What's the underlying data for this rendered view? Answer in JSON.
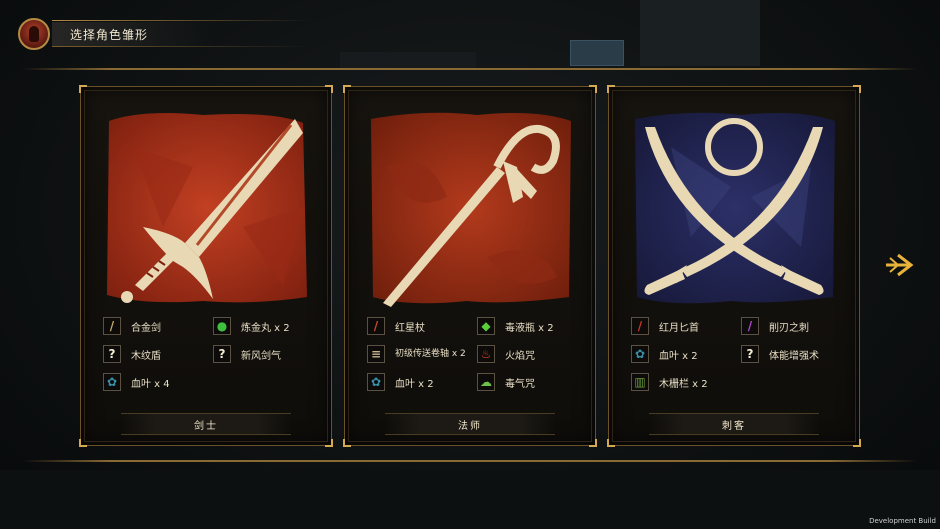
{
  "header": {
    "title": "选择角色雏形"
  },
  "cards": [
    {
      "class_name": "剑士",
      "items": [
        {
          "label": "合金剑",
          "icon": "sword-icon",
          "glyph": "/"
        },
        {
          "label": "炼金丸 x 2",
          "icon": "green-pill-icon",
          "glyph": "●"
        },
        {
          "label": "木纹盾",
          "icon": "unknown-icon",
          "glyph": "?"
        },
        {
          "label": "新风剑气",
          "icon": "unknown-icon",
          "glyph": "?"
        },
        {
          "label": "血叶 x 4",
          "icon": "leaf-icon",
          "glyph": "✿"
        }
      ]
    },
    {
      "class_name": "法师",
      "items": [
        {
          "label": "红星杖",
          "icon": "staff-icon",
          "glyph": "/"
        },
        {
          "label": "毒液瓶 x 2",
          "icon": "potion-icon",
          "glyph": "◆"
        },
        {
          "label": "初级传送卷轴 x 2",
          "icon": "scroll-icon",
          "glyph": "≡"
        },
        {
          "label": "火焰咒",
          "icon": "fire-icon",
          "glyph": "♨"
        },
        {
          "label": "血叶 x 2",
          "icon": "leaf-icon",
          "glyph": "✿"
        },
        {
          "label": "毒气咒",
          "icon": "poison-gas-icon",
          "glyph": "☁"
        }
      ]
    },
    {
      "class_name": "刺客",
      "items": [
        {
          "label": "红月匕首",
          "icon": "dagger-icon",
          "glyph": "/"
        },
        {
          "label": "削刃之刺",
          "icon": "blade-icon",
          "glyph": "/"
        },
        {
          "label": "血叶 x 2",
          "icon": "leaf-icon",
          "glyph": "✿"
        },
        {
          "label": "体能增强术",
          "icon": "unknown-icon",
          "glyph": "?"
        },
        {
          "label": "木栅栏 x 2",
          "icon": "fence-icon",
          "glyph": "▥"
        }
      ]
    }
  ],
  "footer": {
    "build_label": "Development Build"
  },
  "colors": {
    "gold": "#d3a952",
    "warrior_bg": "#a4301a",
    "mage_bg": "#8a2c16",
    "rogue_bg": "#232650"
  }
}
